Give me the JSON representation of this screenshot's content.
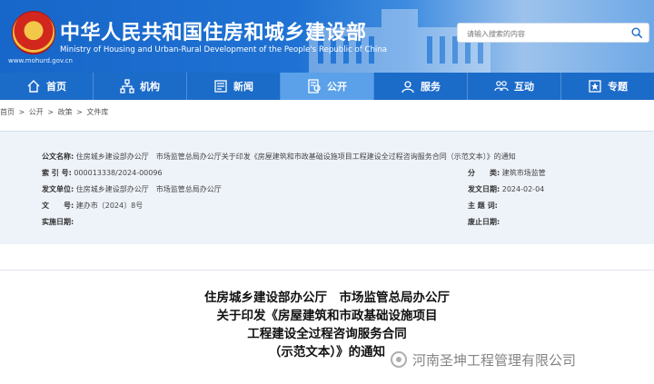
{
  "site": {
    "title": "中华人民共和国住房和城乡建设部",
    "subtitle": "Ministry of Housing and Urban-Rural Development of the People's Republic of China",
    "url": "www.mohurd.gov.cn"
  },
  "search": {
    "placeholder": "请输入搜索的内容"
  },
  "nav": [
    {
      "label": "首页",
      "icon": "home-icon"
    },
    {
      "label": "机构",
      "icon": "organization-icon"
    },
    {
      "label": "新闻",
      "icon": "news-icon"
    },
    {
      "label": "公开",
      "icon": "disclosure-icon",
      "active": true
    },
    {
      "label": "服务",
      "icon": "service-icon"
    },
    {
      "label": "互动",
      "icon": "interaction-icon"
    },
    {
      "label": "专题",
      "icon": "topic-icon"
    }
  ],
  "breadcrumb": [
    "首页",
    ">",
    "公开",
    ">",
    "政策",
    ">",
    "文件库"
  ],
  "meta": {
    "publisher_label": "公文名称:",
    "publisher_value": "住房城乡建设部办公厅　市场监管总局办公厅关于印发《房屋建筑和市政基础设施项目工程建设全过程咨询服务合同（示范文本）》的通知",
    "index_label": "索 引 号:",
    "index_value": "000013338/2024-00096",
    "category_label": "分　　类:",
    "category_value": "建筑市场监管",
    "issuer_label": "发文单位:",
    "issuer_value": "住房城乡建设部办公厅　市场监管总局办公厅",
    "date_label": "发文日期:",
    "date_value": "2024-02-04",
    "docno_label": "文　　号:",
    "docno_value": "建办市〔2024〕8号",
    "topic_label": "主 题 词:",
    "topic_value": "",
    "effective_label": "实施日期:",
    "effective_value": "",
    "expire_label": "废止日期:",
    "expire_value": ""
  },
  "article": {
    "line1": "住房城乡建设部办公厅　市场监管总局办公厅",
    "line2": "关于印发《房屋建筑和市政基础设施项目",
    "line3": "工程建设全过程咨询服务合同",
    "line4": "（示范文本）》的通知"
  },
  "watermark": "河南圣坤工程管理有限公司",
  "colors": {
    "header": "#1766c9",
    "nav": "#1b6bc9",
    "nav_active": "#5aa1ea",
    "meta_bg": "#eef3fa"
  }
}
